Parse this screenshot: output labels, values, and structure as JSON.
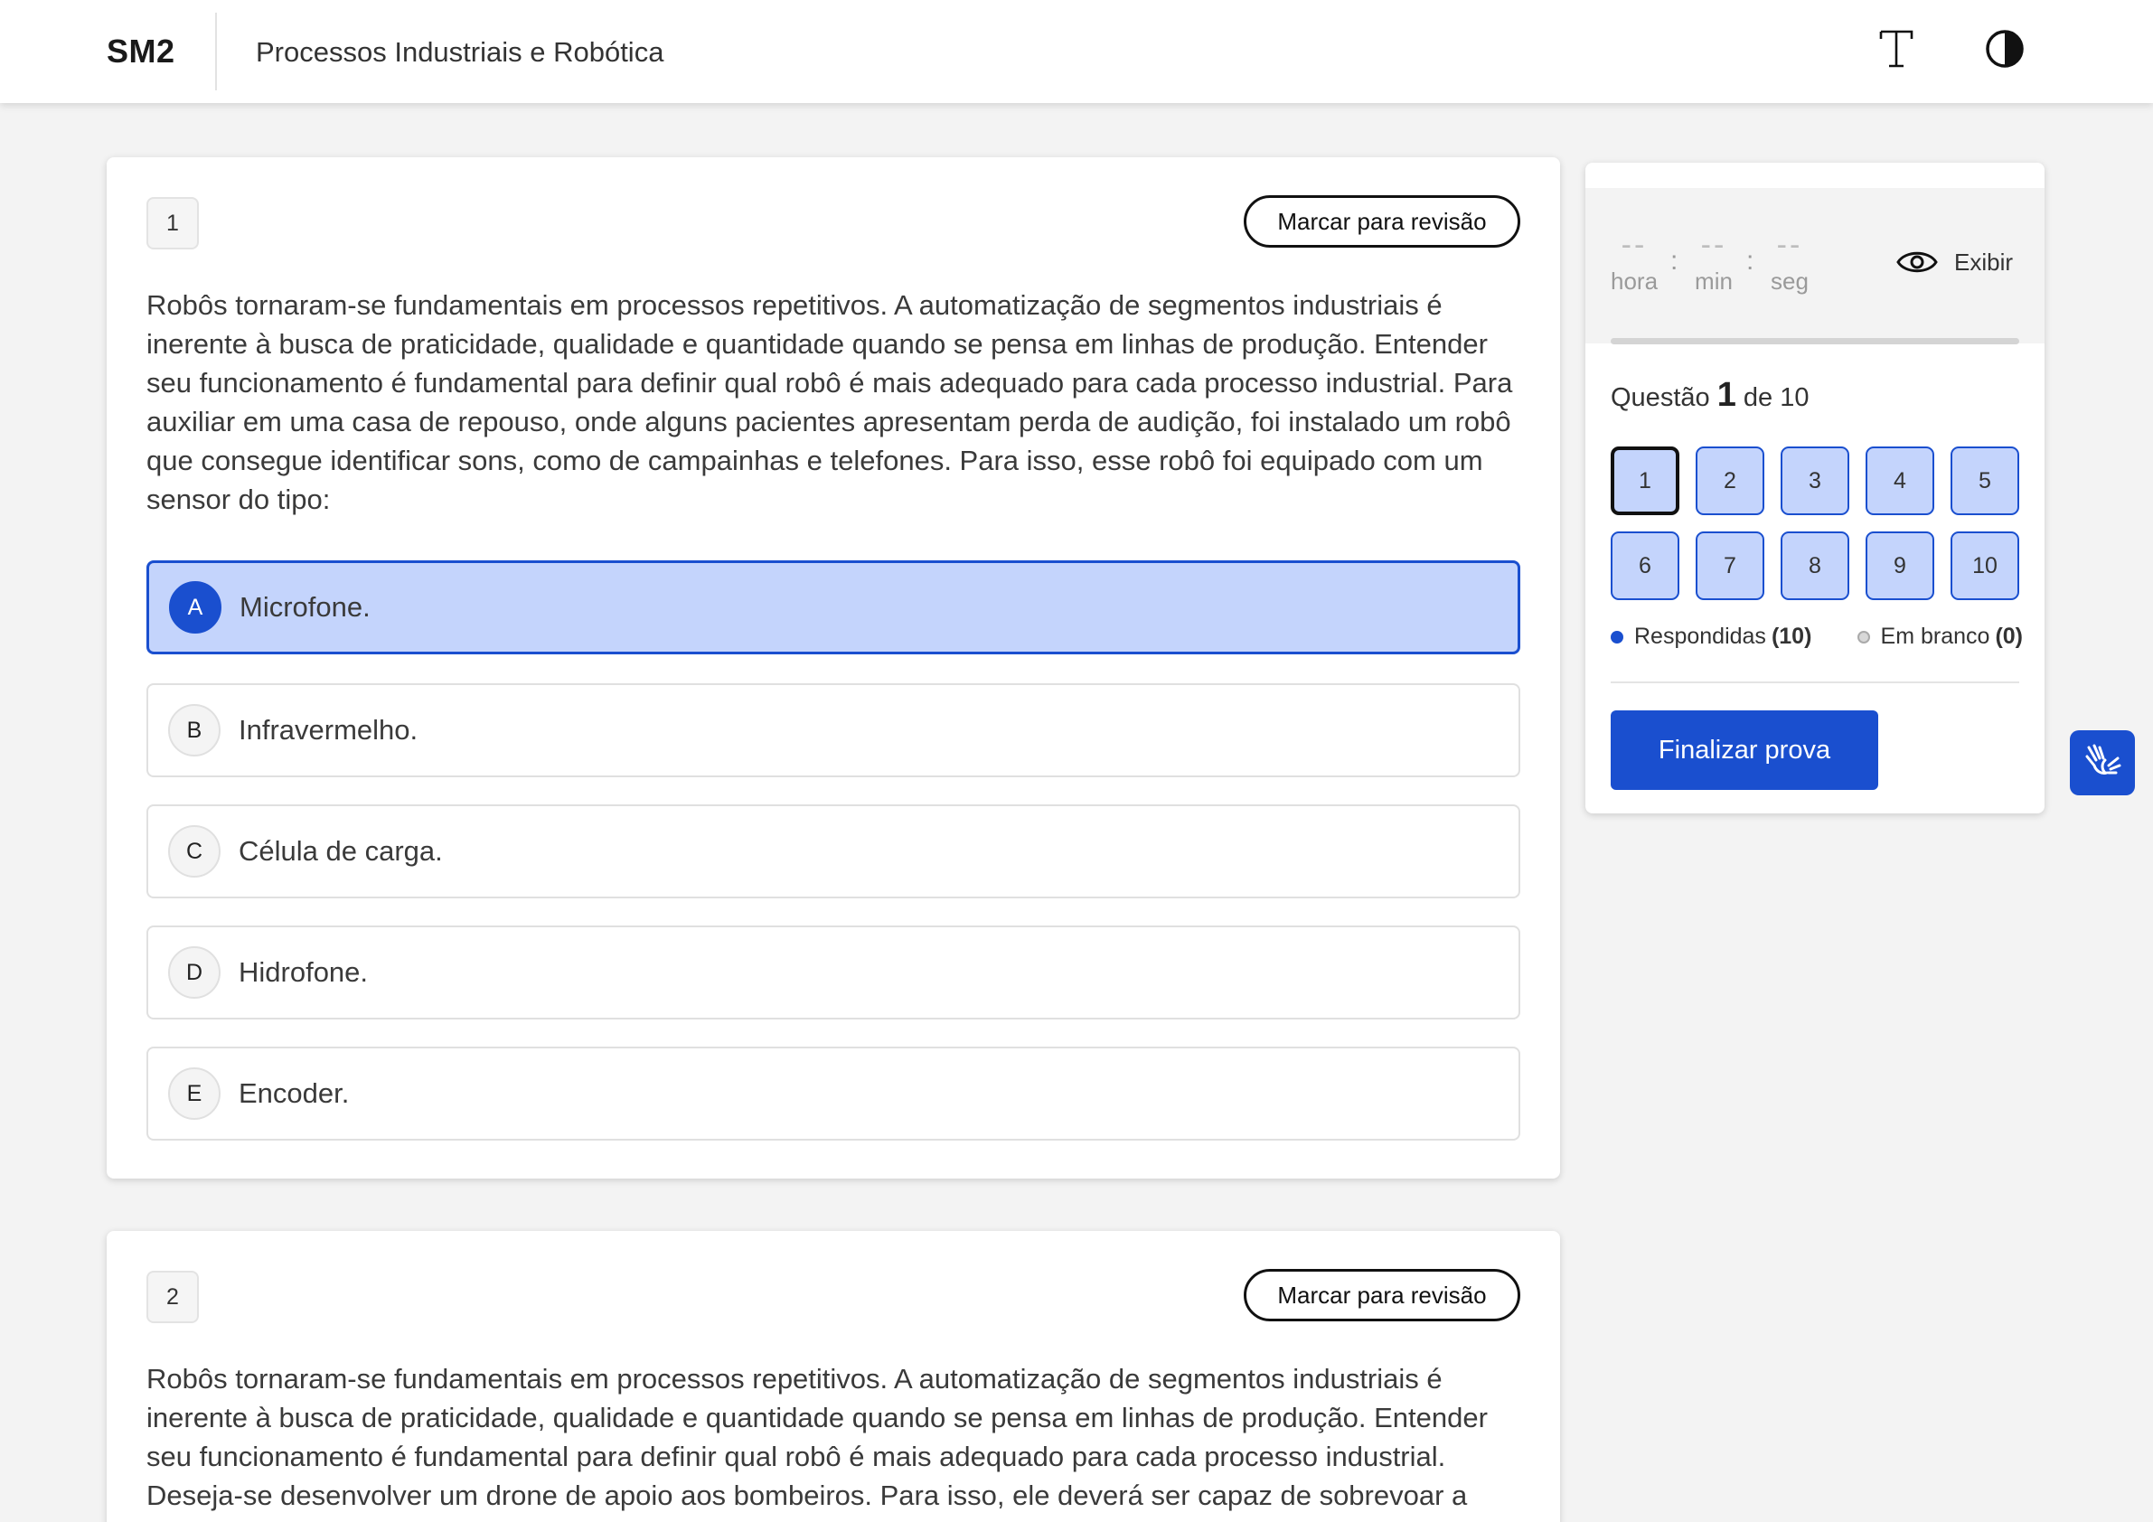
{
  "header": {
    "logo": "SM2",
    "course_title": "Processos Industriais e Robótica",
    "font_icon": "font-size-icon",
    "contrast_icon": "contrast-icon"
  },
  "questions": [
    {
      "number": "1",
      "review_label": "Marcar para revisão",
      "text": "Robôs tornaram-se fundamentais em processos repetitivos. A automatização de segmentos industriais é inerente à busca de praticidade, qualidade e quantidade quando se pensa em linhas de produção. Entender seu funcionamento é fundamental para definir qual robô é mais adequado para cada processo industrial. Para auxiliar em uma casa de repouso, onde alguns pacientes apresentam perda de audição, foi instalado um robô que consegue identificar sons, como de campainhas e telefones. Para isso, esse robô foi equipado com um sensor do tipo:",
      "options": [
        {
          "letter": "A",
          "text": "Microfone.",
          "selected": true
        },
        {
          "letter": "B",
          "text": "Infravermelho.",
          "selected": false
        },
        {
          "letter": "C",
          "text": "Célula de carga.",
          "selected": false
        },
        {
          "letter": "D",
          "text": "Hidrofone.",
          "selected": false
        },
        {
          "letter": "E",
          "text": "Encoder.",
          "selected": false
        }
      ]
    },
    {
      "number": "2",
      "review_label": "Marcar para revisão",
      "text": "Robôs tornaram-se fundamentais em processos repetitivos. A automatização de segmentos industriais é inerente à busca de praticidade, qualidade e quantidade quando se pensa em linhas de produção. Entender seu funcionamento é fundamental para definir qual robô é mais adequado para cada processo industrial. Deseja-se desenvolver um drone de apoio aos bombeiros. Para isso, ele deverá ser capaz de sobrevoar a cidade em"
    }
  ],
  "timer": {
    "hours": "--",
    "minutes": "--",
    "seconds": "--",
    "hours_label": "hora",
    "minutes_label": "min",
    "seconds_label": "seg",
    "separator": ":",
    "show_label": "Exibir",
    "show_icon": "eye-icon"
  },
  "progress": {
    "prefix": "Questão",
    "current": "1",
    "suffix": "de 10",
    "buttons": [
      "1",
      "2",
      "3",
      "4",
      "5",
      "6",
      "7",
      "8",
      "9",
      "10"
    ],
    "answered_label": "Respondidas",
    "answered_count": "(10)",
    "blank_label": "Em branco",
    "blank_count": "(0)"
  },
  "finish_label": "Finalizar prova",
  "accessibility_icon": "sign-language-hands-icon",
  "colors": {
    "accent": "#1a4fcf",
    "selected_bg": "#c4d4fc",
    "page_bg": "#f3f3f3"
  }
}
